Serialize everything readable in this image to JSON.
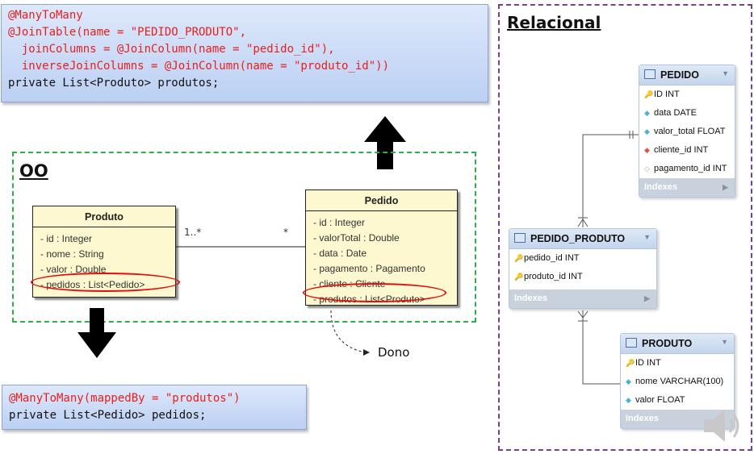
{
  "code_top": {
    "lines": [
      {
        "text": "@ManyToMany",
        "color": "red"
      },
      {
        "text": "@JoinTable(name = \"PEDIDO_PRODUTO\",",
        "color": "red"
      },
      {
        "text": "  joinColumns = @JoinColumn(name = \"pedido_id\"),",
        "color": "red"
      },
      {
        "text": "  inverseJoinColumns = @JoinColumn(name = \"produto_id\"))",
        "color": "red"
      },
      {
        "text": "private List<Produto> produtos;",
        "color": "black"
      }
    ]
  },
  "code_bottom": {
    "lines": [
      {
        "text": "@ManyToMany(mappedBy = \"produtos\")",
        "color": "red"
      },
      {
        "text": "private List<Pedido> pedidos;",
        "color": "black"
      }
    ]
  },
  "oo": {
    "label": "OO",
    "produto": {
      "title": "Produto",
      "attrs": [
        "- id : Integer",
        "- nome : String",
        "- valor : Double",
        "- pedidos : List<Pedido>"
      ]
    },
    "pedido": {
      "title": "Pedido",
      "attrs": [
        "- id : Integer",
        "- valorTotal : Double",
        "- data : Date",
        "- pagamento : Pagamento",
        "- cliente : Cliente",
        "- produtos : List<Produto>"
      ]
    },
    "mult_left": "1..*",
    "mult_right": "*",
    "owner_label": "Dono"
  },
  "relacional": {
    "label": "Relacional",
    "pedido": {
      "title": "PEDIDO",
      "rows": [
        {
          "icon": "key-icon",
          "text": "ID INT"
        },
        {
          "icon": "diamond-icon",
          "text": "data DATE"
        },
        {
          "icon": "diamond-icon",
          "text": "valor_total FLOAT"
        },
        {
          "icon": "fk-diamond-icon",
          "text": "cliente_id INT"
        },
        {
          "icon": "empty-diamond-icon",
          "text": "pagamento_id INT"
        }
      ],
      "indexes": "Indexes"
    },
    "pedido_produto": {
      "title": "PEDIDO_PRODUTO",
      "rows": [
        {
          "icon": "key-icon",
          "text": "pedido_id INT"
        },
        {
          "icon": "key-icon",
          "text": "produto_id INT"
        }
      ],
      "indexes": "Indexes"
    },
    "produto": {
      "title": "PRODUTO",
      "rows": [
        {
          "icon": "key-icon",
          "text": "ID INT"
        },
        {
          "icon": "diamond-icon",
          "text": "nome VARCHAR(100)"
        },
        {
          "icon": "diamond-icon",
          "text": "valor FLOAT"
        }
      ],
      "indexes": "Indexes"
    }
  }
}
